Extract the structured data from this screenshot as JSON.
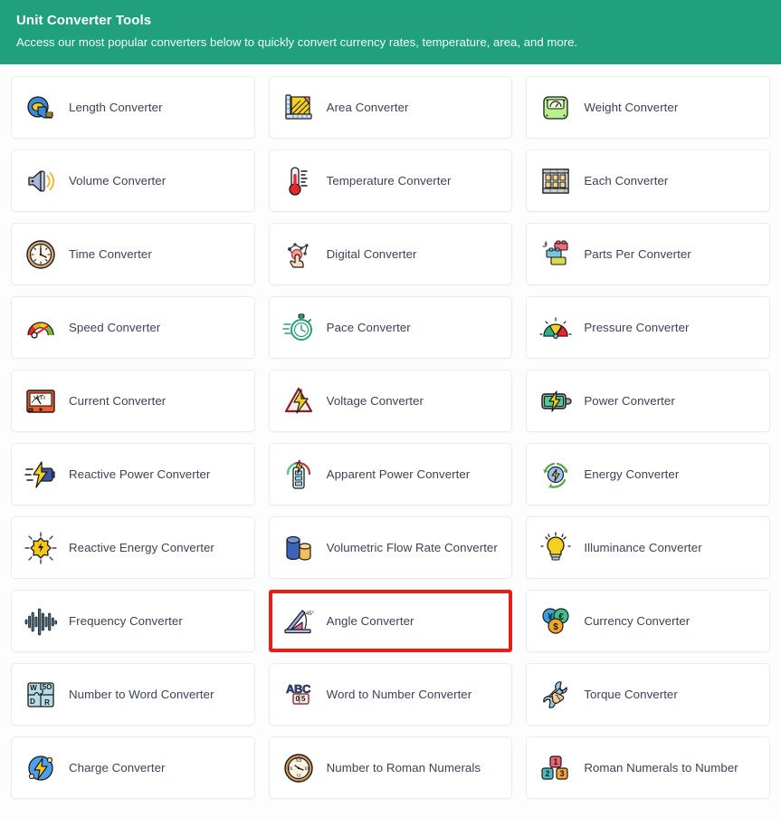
{
  "header": {
    "title": "Unit Converter Tools",
    "subtitle": "Access our most popular converters below to quickly convert currency rates, temperature, area, and more.",
    "bg_color": "#20a07d",
    "text_color": "#ffffff"
  },
  "highlight": {
    "color": "#ee1c17",
    "target": "Angle Converter"
  },
  "grid": {
    "columns": 3,
    "cards": [
      {
        "label": "Length Converter",
        "icon": "tape-measure-icon"
      },
      {
        "label": "Area Converter",
        "icon": "ruler-area-icon"
      },
      {
        "label": "Weight Converter",
        "icon": "weight-scale-icon"
      },
      {
        "label": "Volume Converter",
        "icon": "speaker-volume-icon"
      },
      {
        "label": "Temperature Converter",
        "icon": "thermometer-icon"
      },
      {
        "label": "Each Converter",
        "icon": "crate-boxes-icon"
      },
      {
        "label": "Time Converter",
        "icon": "wall-clock-icon"
      },
      {
        "label": "Digital Converter",
        "icon": "touch-finger-icon"
      },
      {
        "label": "Parts Per Converter",
        "icon": "building-blocks-icon"
      },
      {
        "label": "Speed Converter",
        "icon": "speedometer-icon"
      },
      {
        "label": "Pace Converter",
        "icon": "stopwatch-icon"
      },
      {
        "label": "Pressure Converter",
        "icon": "pressure-gauge-icon"
      },
      {
        "label": "Current Converter",
        "icon": "ammeter-icon"
      },
      {
        "label": "Voltage Converter",
        "icon": "high-voltage-icon"
      },
      {
        "label": "Power Converter",
        "icon": "battery-bolt-icon"
      },
      {
        "label": "Reactive Power Converter",
        "icon": "bolt-battery-motion-icon"
      },
      {
        "label": "Apparent Power Converter",
        "icon": "power-meter-icon"
      },
      {
        "label": "Energy Converter",
        "icon": "energy-recycle-icon"
      },
      {
        "label": "Reactive Energy Converter",
        "icon": "energy-burst-icon"
      },
      {
        "label": "Volumetric Flow Rate Converter",
        "icon": "cylinders-icon"
      },
      {
        "label": "Illuminance Converter",
        "icon": "light-bulb-icon"
      },
      {
        "label": "Frequency Converter",
        "icon": "waveform-icon"
      },
      {
        "label": "Angle Converter",
        "icon": "protractor-angle-icon"
      },
      {
        "label": "Currency Converter",
        "icon": "currency-coins-icon"
      },
      {
        "label": "Number to Word Converter",
        "icon": "puzzle-letters-icon"
      },
      {
        "label": "Word to Number Converter",
        "icon": "abc-block-icon"
      },
      {
        "label": "Torque Converter",
        "icon": "wrench-hand-icon"
      },
      {
        "label": "Charge Converter",
        "icon": "charge-bolt-icon"
      },
      {
        "label": "Number to Roman Numerals",
        "icon": "roman-clock-icon"
      },
      {
        "label": "Roman Numerals to Number",
        "icon": "number-blocks-icon"
      }
    ]
  }
}
